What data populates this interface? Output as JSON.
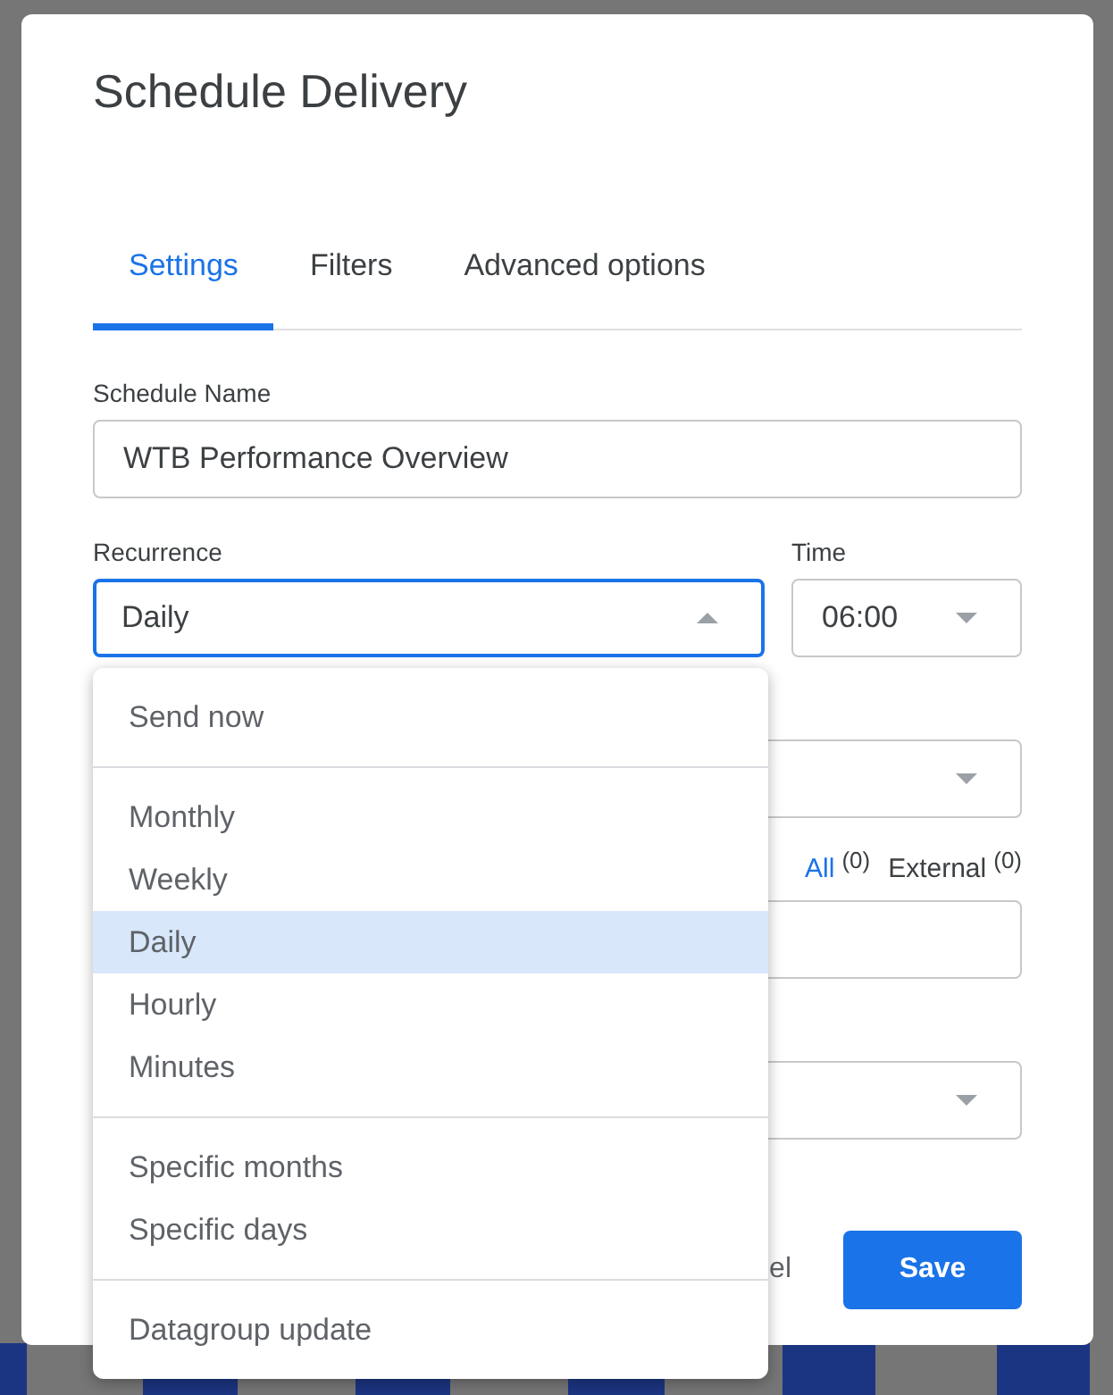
{
  "dialog": {
    "title": "Schedule Delivery",
    "tabs": [
      {
        "label": "Settings",
        "selected": true
      },
      {
        "label": "Filters",
        "selected": false
      },
      {
        "label": "Advanced options",
        "selected": false
      }
    ],
    "schedule_name": {
      "label": "Schedule Name",
      "value": "WTB Performance Overview"
    },
    "recurrence": {
      "label": "Recurrence",
      "value": "Daily",
      "expanded": true
    },
    "time": {
      "label": "Time",
      "value": "06:00",
      "expanded": false
    },
    "recipient_tabs": [
      {
        "label": "All",
        "count": "(0)",
        "selected": true
      },
      {
        "label": "External",
        "count": "(0)",
        "selected": false
      }
    ],
    "buttons": [
      {
        "kind": "text",
        "label": "el"
      },
      {
        "kind": "primary",
        "label": "Save"
      }
    ]
  },
  "recurrence_menu": [
    {
      "items": [
        {
          "label": "Send now",
          "selected": false
        }
      ]
    },
    {
      "items": [
        {
          "label": "Monthly",
          "selected": false
        },
        {
          "label": "Weekly",
          "selected": false
        },
        {
          "label": "Daily",
          "selected": true
        },
        {
          "label": "Hourly",
          "selected": false
        },
        {
          "label": "Minutes",
          "selected": false
        }
      ]
    },
    {
      "items": [
        {
          "label": "Specific months",
          "selected": false
        },
        {
          "label": "Specific days",
          "selected": false
        }
      ]
    },
    {
      "items": [
        {
          "label": "Datagroup update",
          "selected": false
        }
      ]
    }
  ]
}
